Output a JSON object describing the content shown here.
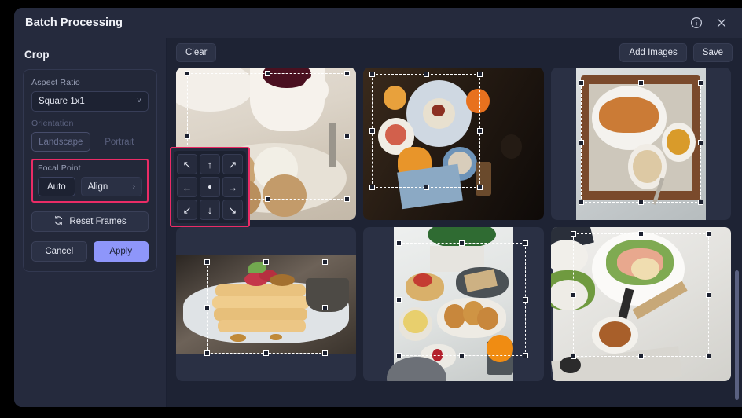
{
  "window": {
    "title": "Batch Processing",
    "info_icon": "info-circle-icon",
    "close_icon": "close-x-icon"
  },
  "sidebar": {
    "section_title": "Crop",
    "aspect_ratio": {
      "label": "Aspect Ratio",
      "value": "Square 1x1",
      "chevron": "˅"
    },
    "orientation": {
      "label": "Orientation",
      "options": [
        "Landscape",
        "Portrait"
      ],
      "selected": "Landscape",
      "disabled": true
    },
    "focal_point": {
      "label": "Focal Point",
      "auto_label": "Auto",
      "align_label": "Align",
      "chevron": "›",
      "highlight_color": "#EA2C66"
    },
    "reset_frames": {
      "label": "Reset Frames",
      "icon": "refresh-icon"
    },
    "cancel_label": "Cancel",
    "apply_label": "Apply",
    "apply_color": "#8E96FA"
  },
  "dpad": {
    "highlight_color": "#EA2C66",
    "keys": [
      {
        "name": "align-top-left",
        "glyph": "↖"
      },
      {
        "name": "align-top",
        "glyph": "↑"
      },
      {
        "name": "align-top-right",
        "glyph": "↗"
      },
      {
        "name": "align-left",
        "glyph": "←"
      },
      {
        "name": "align-center",
        "glyph": ""
      },
      {
        "name": "align-right",
        "glyph": "→"
      },
      {
        "name": "align-bottom-left",
        "glyph": "↙"
      },
      {
        "name": "align-bottom",
        "glyph": "↓"
      },
      {
        "name": "align-bottom-right",
        "glyph": "↘"
      }
    ]
  },
  "toolbar": {
    "clear_label": "Clear",
    "add_images_label": "Add Images",
    "save_label": "Save"
  },
  "gallery": {
    "items": [
      {
        "name": "scones-and-tea",
        "style": "ph-scones"
      },
      {
        "name": "dark-breakfast-spread",
        "style": "ph-dark"
      },
      {
        "name": "croissant-on-tray",
        "style": "ph-tray"
      },
      {
        "name": "pancake-stack",
        "style": "ph-pancake"
      },
      {
        "name": "brunch-table",
        "style": "ph-brunch"
      },
      {
        "name": "salad-and-coffee",
        "style": "ph-marble"
      }
    ]
  }
}
